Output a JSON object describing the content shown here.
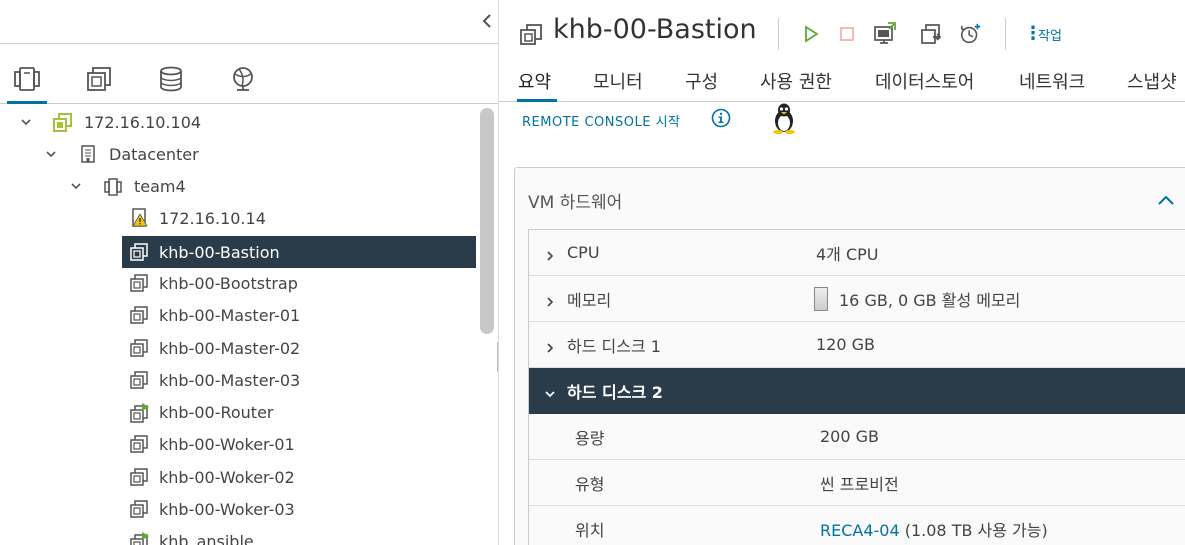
{
  "nav": {
    "tabs": [
      "hosts-and-clusters",
      "vms-and-templates",
      "storage",
      "networking"
    ],
    "active_tab": "hosts-and-clusters"
  },
  "tree": {
    "items": [
      {
        "label": "172.16.10.104",
        "icon": "vcenter-icon"
      },
      {
        "label": "Datacenter",
        "icon": "datacenter-icon"
      },
      {
        "label": "team4",
        "icon": "cluster-icon"
      },
      {
        "label": "172.16.10.14",
        "icon": "host-warning-icon"
      },
      {
        "label": "khb-00-Bastion",
        "icon": "vm-icon"
      },
      {
        "label": "khb-00-Bootstrap",
        "icon": "vm-icon"
      },
      {
        "label": "khb-00-Master-01",
        "icon": "vm-icon"
      },
      {
        "label": "khb-00-Master-02",
        "icon": "vm-icon"
      },
      {
        "label": "khb-00-Master-03",
        "icon": "vm-icon"
      },
      {
        "label": "khb-00-Router",
        "icon": "vm-powered-on-icon"
      },
      {
        "label": "khb-00-Woker-01",
        "icon": "vm-icon"
      },
      {
        "label": "khb-00-Woker-02",
        "icon": "vm-icon"
      },
      {
        "label": "khb-00-Woker-03",
        "icon": "vm-icon"
      },
      {
        "label": "khb_ansible",
        "icon": "vm-powered-on-icon"
      }
    ],
    "selected": "khb-00-Bastion"
  },
  "header": {
    "title": "khb-00-Bastion",
    "actions_label": "작업",
    "toolbar_icons": [
      "power-on-icon",
      "power-off-icon",
      "open-console-icon",
      "migrate-icon",
      "snapshot-icon"
    ]
  },
  "subtabs": [
    "요약",
    "모니터",
    "구성",
    "사용 권한",
    "데이터스토어",
    "네트워크",
    "스냅샷"
  ],
  "remote_console": "REMOTE CONSOLE 시작",
  "hardware": {
    "title": "VM 하드웨어",
    "rows": [
      {
        "key": "CPU",
        "value": "4개 CPU"
      },
      {
        "key": "메모리",
        "value": "16 GB, 0 GB 활성 메모리"
      },
      {
        "key": "하드 디스크 1",
        "value": "120 GB"
      },
      {
        "key": "하드 디스크 2",
        "value": ""
      },
      {
        "key": "용량",
        "value": "200 GB"
      },
      {
        "key": "유형",
        "value": "씬 프로비전"
      },
      {
        "key": "위치",
        "value_link": "RECA4-04",
        "value_suffix": " (1.08 TB 사용 가능)"
      }
    ]
  },
  "colors": {
    "accent": "#0072a3",
    "selected_bg": "#2a3c49",
    "vm_green": "#61a830",
    "warning": "#f5c400",
    "vcenter": "#a4c33b"
  }
}
